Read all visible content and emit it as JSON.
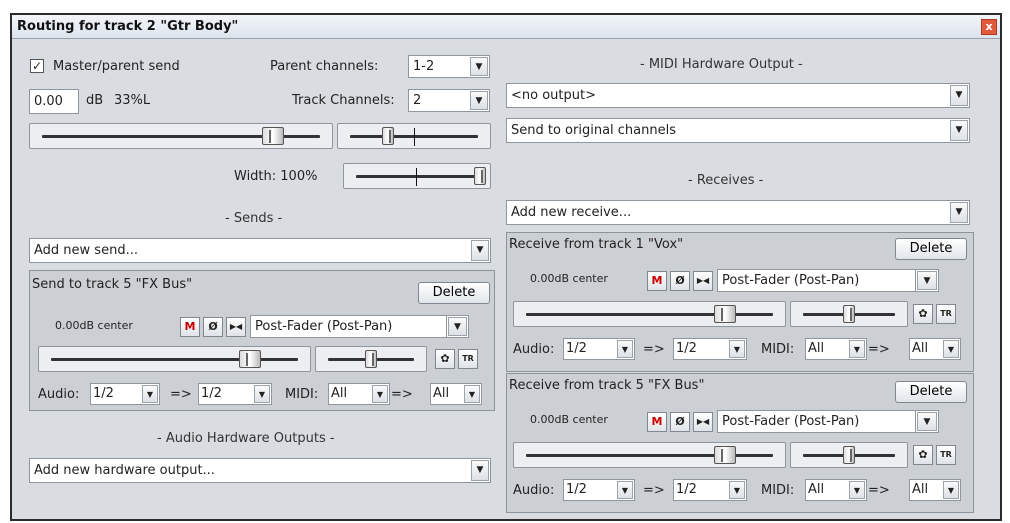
{
  "window": {
    "title": "Routing for track 2 \"Gtr Body\"",
    "close": "x"
  },
  "master": {
    "send_label": "Master/parent send",
    "checked": "✓",
    "parent_channels_label": "Parent channels:",
    "parent_channels_value": "1-2",
    "volume_value": "0.00",
    "volume_unit": "dB",
    "pan_text": "33%L",
    "track_channels_label": "Track Channels:",
    "track_channels_value": "2",
    "width_label": "Width: 100%"
  },
  "sends": {
    "header": "- Sends -",
    "add_placeholder": "Add new send...",
    "items": [
      {
        "title": "Send to track 5 \"FX Bus\"",
        "delete": "Delete",
        "level": "0.00dB center",
        "mode": "Post-Fader (Post-Pan)",
        "audio_label": "Audio:",
        "audio_src": "1/2",
        "arrow": "=>",
        "audio_dst": "1/2",
        "midi_label": "MIDI:",
        "midi_src": "All",
        "midi_arrow": "=>",
        "midi_dst": "All"
      }
    ]
  },
  "hw_outputs": {
    "header": "- Audio Hardware Outputs -",
    "add_placeholder": "Add new hardware output..."
  },
  "midi_hw": {
    "header": "- MIDI Hardware Output -",
    "output": "<no output>",
    "channels": "Send to original channels"
  },
  "receives": {
    "header": "- Receives -",
    "add_placeholder": "Add new receive...",
    "items": [
      {
        "title": "Receive from track 1 \"Vox\"",
        "delete": "Delete",
        "level": "0.00dB center",
        "mode": "Post-Fader (Post-Pan)",
        "audio_label": "Audio:",
        "audio_src": "1/2",
        "arrow": "=>",
        "audio_dst": "1/2",
        "midi_label": "MIDI:",
        "midi_src": "All",
        "midi_arrow": "=>",
        "midi_dst": "All"
      },
      {
        "title": "Receive from track 5 \"FX Bus\"",
        "delete": "Delete",
        "level": "0.00dB center",
        "mode": "Post-Fader (Post-Pan)",
        "audio_label": "Audio:",
        "audio_src": "1/2",
        "arrow": "=>",
        "audio_dst": "1/2",
        "midi_label": "MIDI:",
        "midi_src": "All",
        "midi_arrow": "=>",
        "midi_dst": "All"
      }
    ]
  },
  "buttons": {
    "mute": "M",
    "phase": "Ø",
    "mono": "▶◀",
    "env": "✿",
    "tr": "TR"
  },
  "dropdown_arrow": "▼",
  "colors": {
    "titlebar": "#dbe3ec",
    "window_bg": "#d9dde2",
    "panel_bg": "#ccd0d5",
    "mute_red": "#cc0000",
    "close_red": "#e15a3e"
  },
  "icons": {
    "close": "close-icon",
    "dropdown": "chevron-down-icon",
    "env": "envelope-icon",
    "tr": "trim-icon"
  }
}
